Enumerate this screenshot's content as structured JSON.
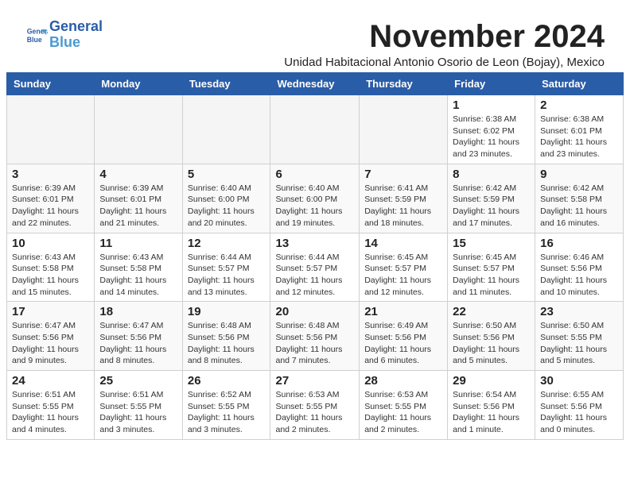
{
  "header": {
    "logo_line1": "General",
    "logo_line2": "Blue",
    "month": "November 2024",
    "subtitle": "Unidad Habitacional Antonio Osorio de Leon (Bojay), Mexico"
  },
  "weekdays": [
    "Sunday",
    "Monday",
    "Tuesday",
    "Wednesday",
    "Thursday",
    "Friday",
    "Saturday"
  ],
  "weeks": [
    [
      {
        "day": "",
        "info": ""
      },
      {
        "day": "",
        "info": ""
      },
      {
        "day": "",
        "info": ""
      },
      {
        "day": "",
        "info": ""
      },
      {
        "day": "",
        "info": ""
      },
      {
        "day": "1",
        "info": "Sunrise: 6:38 AM\nSunset: 6:02 PM\nDaylight: 11 hours and 23 minutes."
      },
      {
        "day": "2",
        "info": "Sunrise: 6:38 AM\nSunset: 6:01 PM\nDaylight: 11 hours and 23 minutes."
      }
    ],
    [
      {
        "day": "3",
        "info": "Sunrise: 6:39 AM\nSunset: 6:01 PM\nDaylight: 11 hours and 22 minutes."
      },
      {
        "day": "4",
        "info": "Sunrise: 6:39 AM\nSunset: 6:01 PM\nDaylight: 11 hours and 21 minutes."
      },
      {
        "day": "5",
        "info": "Sunrise: 6:40 AM\nSunset: 6:00 PM\nDaylight: 11 hours and 20 minutes."
      },
      {
        "day": "6",
        "info": "Sunrise: 6:40 AM\nSunset: 6:00 PM\nDaylight: 11 hours and 19 minutes."
      },
      {
        "day": "7",
        "info": "Sunrise: 6:41 AM\nSunset: 5:59 PM\nDaylight: 11 hours and 18 minutes."
      },
      {
        "day": "8",
        "info": "Sunrise: 6:42 AM\nSunset: 5:59 PM\nDaylight: 11 hours and 17 minutes."
      },
      {
        "day": "9",
        "info": "Sunrise: 6:42 AM\nSunset: 5:58 PM\nDaylight: 11 hours and 16 minutes."
      }
    ],
    [
      {
        "day": "10",
        "info": "Sunrise: 6:43 AM\nSunset: 5:58 PM\nDaylight: 11 hours and 15 minutes."
      },
      {
        "day": "11",
        "info": "Sunrise: 6:43 AM\nSunset: 5:58 PM\nDaylight: 11 hours and 14 minutes."
      },
      {
        "day": "12",
        "info": "Sunrise: 6:44 AM\nSunset: 5:57 PM\nDaylight: 11 hours and 13 minutes."
      },
      {
        "day": "13",
        "info": "Sunrise: 6:44 AM\nSunset: 5:57 PM\nDaylight: 11 hours and 12 minutes."
      },
      {
        "day": "14",
        "info": "Sunrise: 6:45 AM\nSunset: 5:57 PM\nDaylight: 11 hours and 12 minutes."
      },
      {
        "day": "15",
        "info": "Sunrise: 6:45 AM\nSunset: 5:57 PM\nDaylight: 11 hours and 11 minutes."
      },
      {
        "day": "16",
        "info": "Sunrise: 6:46 AM\nSunset: 5:56 PM\nDaylight: 11 hours and 10 minutes."
      }
    ],
    [
      {
        "day": "17",
        "info": "Sunrise: 6:47 AM\nSunset: 5:56 PM\nDaylight: 11 hours and 9 minutes."
      },
      {
        "day": "18",
        "info": "Sunrise: 6:47 AM\nSunset: 5:56 PM\nDaylight: 11 hours and 8 minutes."
      },
      {
        "day": "19",
        "info": "Sunrise: 6:48 AM\nSunset: 5:56 PM\nDaylight: 11 hours and 8 minutes."
      },
      {
        "day": "20",
        "info": "Sunrise: 6:48 AM\nSunset: 5:56 PM\nDaylight: 11 hours and 7 minutes."
      },
      {
        "day": "21",
        "info": "Sunrise: 6:49 AM\nSunset: 5:56 PM\nDaylight: 11 hours and 6 minutes."
      },
      {
        "day": "22",
        "info": "Sunrise: 6:50 AM\nSunset: 5:56 PM\nDaylight: 11 hours and 5 minutes."
      },
      {
        "day": "23",
        "info": "Sunrise: 6:50 AM\nSunset: 5:55 PM\nDaylight: 11 hours and 5 minutes."
      }
    ],
    [
      {
        "day": "24",
        "info": "Sunrise: 6:51 AM\nSunset: 5:55 PM\nDaylight: 11 hours and 4 minutes."
      },
      {
        "day": "25",
        "info": "Sunrise: 6:51 AM\nSunset: 5:55 PM\nDaylight: 11 hours and 3 minutes."
      },
      {
        "day": "26",
        "info": "Sunrise: 6:52 AM\nSunset: 5:55 PM\nDaylight: 11 hours and 3 minutes."
      },
      {
        "day": "27",
        "info": "Sunrise: 6:53 AM\nSunset: 5:55 PM\nDaylight: 11 hours and 2 minutes."
      },
      {
        "day": "28",
        "info": "Sunrise: 6:53 AM\nSunset: 5:55 PM\nDaylight: 11 hours and 2 minutes."
      },
      {
        "day": "29",
        "info": "Sunrise: 6:54 AM\nSunset: 5:56 PM\nDaylight: 11 hours and 1 minute."
      },
      {
        "day": "30",
        "info": "Sunrise: 6:55 AM\nSunset: 5:56 PM\nDaylight: 11 hours and 0 minutes."
      }
    ]
  ]
}
